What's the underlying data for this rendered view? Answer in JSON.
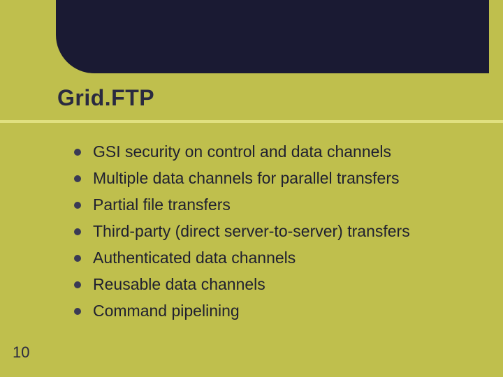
{
  "title": "Grid.FTP",
  "bullets": [
    "GSI security on control and data channels",
    "Multiple data channels for parallel transfers",
    "Partial file transfers",
    "Third-party (direct server-to-server) transfers",
    "Authenticated data channels",
    "Reusable data channels",
    "Command pipelining"
  ],
  "page_number": "10"
}
